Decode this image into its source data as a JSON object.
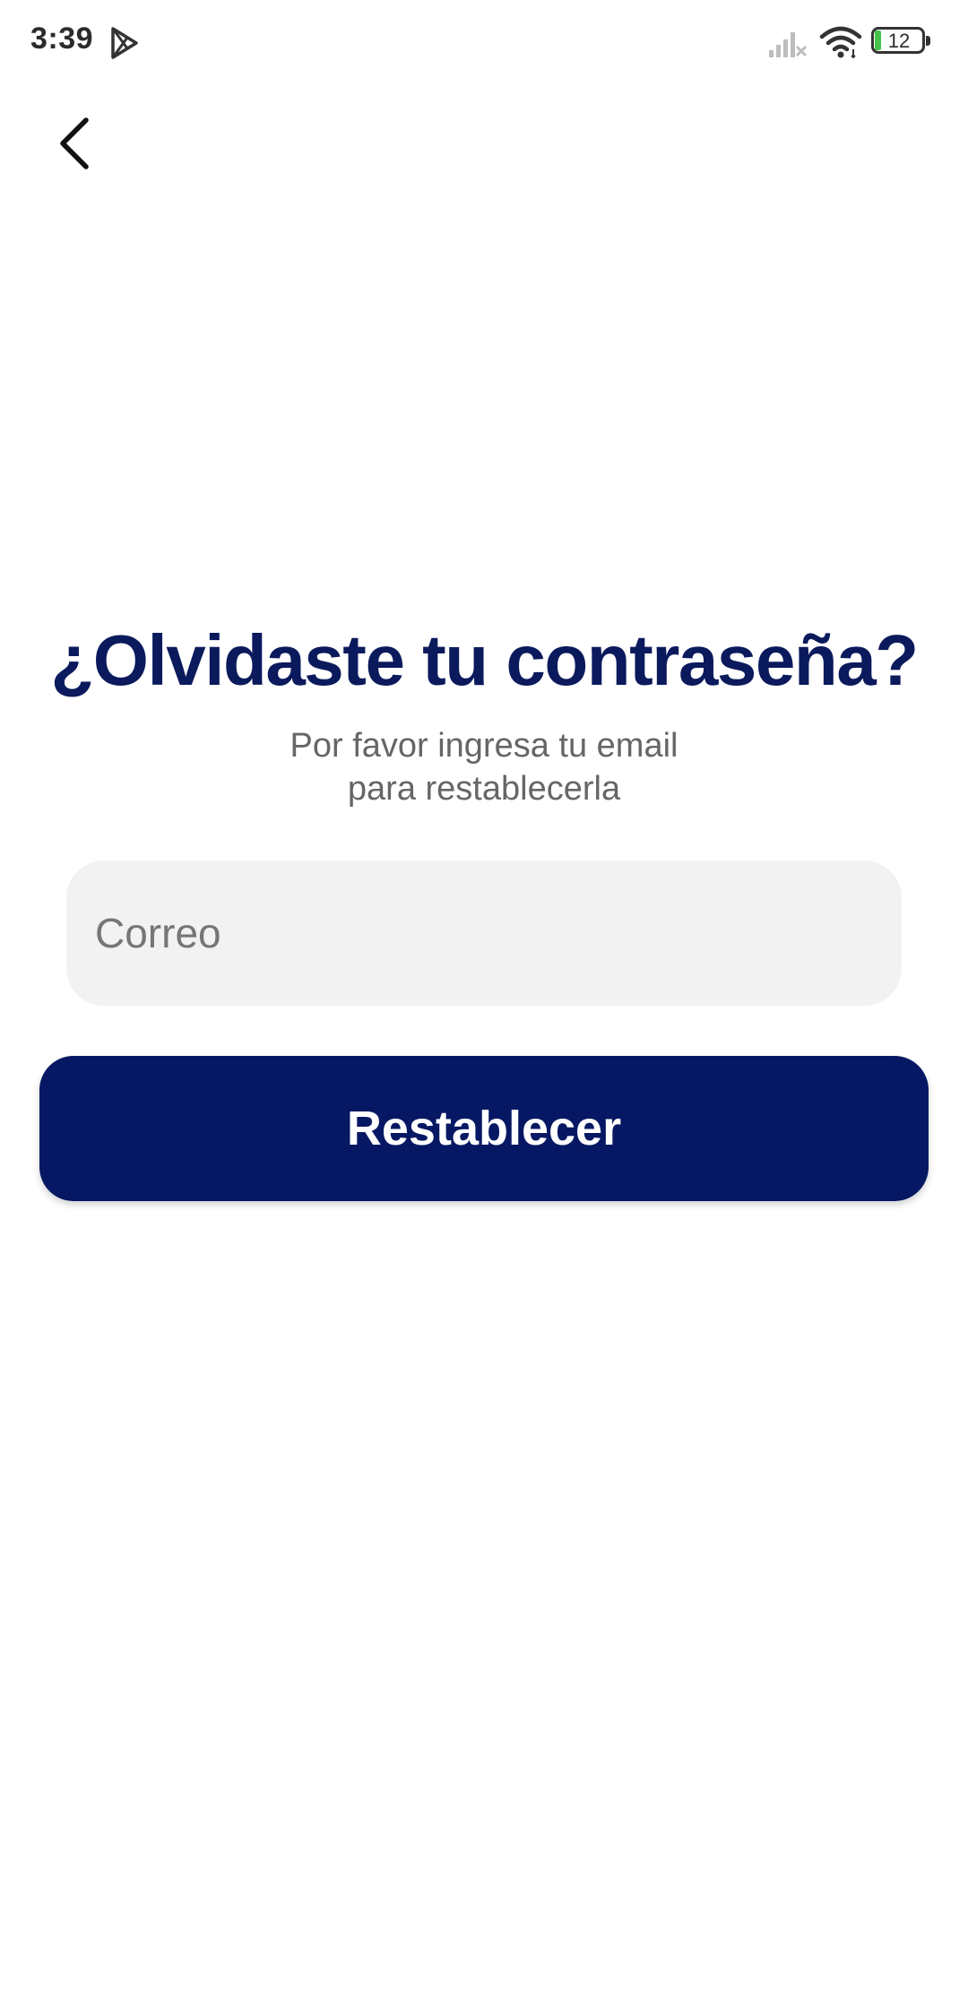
{
  "status_bar": {
    "time": "3:39",
    "battery_level": "12",
    "icons": [
      "play-store-icon",
      "signal-icon",
      "wifi-icon",
      "battery-icon"
    ]
  },
  "nav": {
    "back_icon": "chevron-left-icon"
  },
  "content": {
    "title": "¿Olvidaste tu contraseña?",
    "subtitle_line1": "Por favor ingresa tu email",
    "subtitle_line2": "para restablecerla",
    "email_placeholder": "Correo",
    "email_value": "",
    "submit_label": "Restablecer"
  },
  "colors": {
    "primary": "#061863",
    "title": "#0b1a5c",
    "subtitle": "#666666",
    "input_background": "#f2f2f2",
    "battery_fill": "#44c24a"
  }
}
